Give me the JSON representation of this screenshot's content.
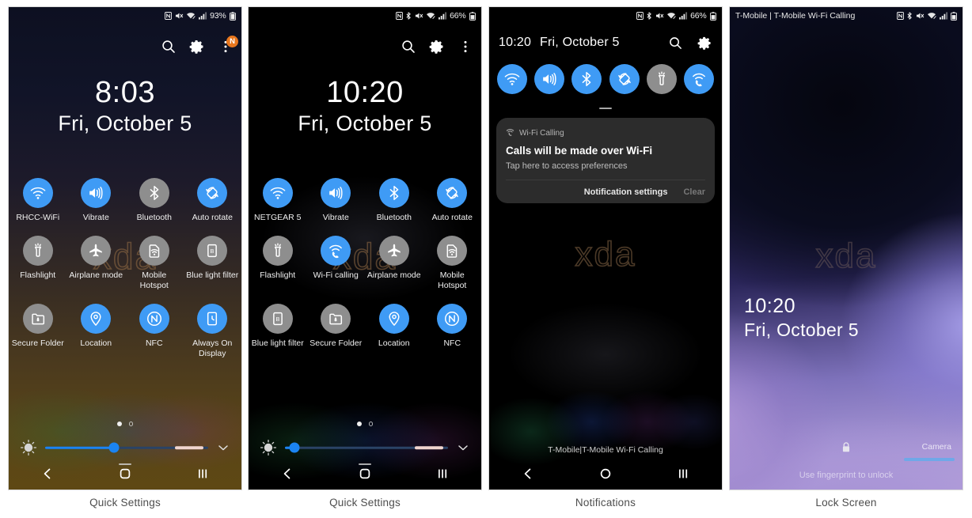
{
  "captions": [
    {
      "label": "Quick Settings"
    },
    {
      "label": "Quick Settings"
    },
    {
      "label": "Notifications"
    },
    {
      "label": "Lock Screen"
    }
  ],
  "panel1": {
    "name": "quick-settings-expanded-warm",
    "statusbar": {
      "left": "",
      "battery_percent": "93%",
      "icons": [
        "nfc-icon",
        "mute-icon",
        "wifi-icon",
        "signal-icon",
        "battery-icon"
      ]
    },
    "header": {
      "search_icon": "search-icon",
      "settings_icon": "gear-icon",
      "overflow_icon": "more-vertical-icon",
      "badge_label": "N"
    },
    "clock": {
      "time": "8:03",
      "date": "Fri, October 5"
    },
    "watermark": "xda",
    "tiles": [
      {
        "label": "RHCC-WiFi",
        "icon": "wifi-icon",
        "state": "on"
      },
      {
        "label": "Vibrate",
        "icon": "vibrate-icon",
        "state": "on"
      },
      {
        "label": "Bluetooth",
        "icon": "bluetooth-icon",
        "state": "off"
      },
      {
        "label": "Auto rotate",
        "icon": "autorotate-icon",
        "state": "on"
      },
      {
        "label": "Flashlight",
        "icon": "flashlight-icon",
        "state": "off"
      },
      {
        "label": "Airplane mode",
        "icon": "airplane-icon",
        "state": "off"
      },
      {
        "label": "Mobile Hotspot",
        "icon": "hotspot-icon",
        "state": "off"
      },
      {
        "label": "Blue light filter",
        "icon": "bluelight-icon",
        "state": "off"
      },
      {
        "label": "Secure Folder",
        "icon": "securefolder-icon",
        "state": "off"
      },
      {
        "label": "Location",
        "icon": "location-icon",
        "state": "on"
      },
      {
        "label": "NFC",
        "icon": "nfc-icon",
        "state": "on"
      },
      {
        "label": "Always On Display",
        "icon": "aod-icon",
        "state": "on"
      }
    ],
    "pages": {
      "current": 1,
      "total": 2
    },
    "brightness": {
      "value_percent": 42,
      "auto": true
    },
    "navbar": {
      "back": "back-icon",
      "home": "home-icon",
      "recents": "recents-icon"
    }
  },
  "panel2": {
    "name": "quick-settings-expanded-dark",
    "statusbar": {
      "left": "",
      "battery_percent": "66%",
      "icons": [
        "nfc-icon",
        "bluetooth-icon",
        "mute-icon",
        "wifi-icon",
        "signal-icon",
        "battery-icon"
      ]
    },
    "header": {
      "search_icon": "search-icon",
      "settings_icon": "gear-icon",
      "overflow_icon": "more-vertical-icon"
    },
    "clock": {
      "time": "10:20",
      "date": "Fri, October 5"
    },
    "watermark": "xda",
    "tiles": [
      {
        "label": "NETGEAR 5",
        "icon": "wifi-icon",
        "state": "on"
      },
      {
        "label": "Vibrate",
        "icon": "vibrate-icon",
        "state": "on"
      },
      {
        "label": "Bluetooth",
        "icon": "bluetooth-icon",
        "state": "on"
      },
      {
        "label": "Auto rotate",
        "icon": "autorotate-icon",
        "state": "on"
      },
      {
        "label": "Flashlight",
        "icon": "flashlight-icon",
        "state": "off"
      },
      {
        "label": "Wi-Fi calling",
        "icon": "wificalling-icon",
        "state": "on"
      },
      {
        "label": "Airplane mode",
        "icon": "airplane-icon",
        "state": "off"
      },
      {
        "label": "Mobile Hotspot",
        "icon": "hotspot-icon",
        "state": "off"
      },
      {
        "label": "Blue light filter",
        "icon": "bluelight-icon",
        "state": "off"
      },
      {
        "label": "Secure Folder",
        "icon": "securefolder-icon",
        "state": "off"
      },
      {
        "label": "Location",
        "icon": "location-icon",
        "state": "on"
      },
      {
        "label": "NFC",
        "icon": "nfc-icon",
        "state": "on"
      }
    ],
    "pages": {
      "current": 1,
      "total": 2
    },
    "brightness": {
      "value_percent": 6,
      "auto": true
    },
    "navbar": {
      "back": "back-icon",
      "home": "home-icon",
      "recents": "recents-icon"
    }
  },
  "panel3": {
    "name": "notification-shade",
    "statusbar": {
      "left": "",
      "battery_percent": "66%",
      "icons": [
        "nfc-icon",
        "bluetooth-icon",
        "mute-icon",
        "wifi-icon",
        "signal-icon",
        "battery-icon"
      ]
    },
    "header": {
      "time": "10:20",
      "date": "Fri, October 5",
      "search_icon": "search-icon",
      "settings_icon": "gear-icon"
    },
    "quick_tiles": [
      {
        "label": "Wi-Fi",
        "icon": "wifi-icon",
        "state": "on"
      },
      {
        "label": "Vibrate",
        "icon": "vibrate-icon",
        "state": "on"
      },
      {
        "label": "Bluetooth",
        "icon": "bluetooth-icon",
        "state": "on"
      },
      {
        "label": "Auto rotate",
        "icon": "autorotate-icon",
        "state": "on"
      },
      {
        "label": "Flashlight",
        "icon": "flashlight-icon",
        "state": "off"
      },
      {
        "label": "Wi-Fi calling",
        "icon": "wificalling-icon",
        "state": "on"
      }
    ],
    "notification": {
      "app_icon": "wificalling-icon",
      "app_name": "Wi-Fi Calling",
      "title": "Calls will be made over Wi-Fi",
      "body": "Tap here to access preferences",
      "action_settings": "Notification settings",
      "action_clear": "Clear"
    },
    "watermark": "xda",
    "carrier": "T-Mobile|T-Mobile Wi-Fi Calling",
    "navbar": {
      "back": "back-icon",
      "home": "home-icon",
      "recents": "recents-icon"
    }
  },
  "panel4": {
    "name": "lock-screen",
    "statusbar": {
      "left": "T-Mobile | T-Mobile Wi-Fi Calling",
      "battery_percent": "",
      "icons": [
        "nfc-icon",
        "bluetooth-icon",
        "mute-icon",
        "wifi-icon",
        "signal-icon",
        "battery-icon"
      ]
    },
    "watermark": "xda",
    "clock": {
      "time": "10:20",
      "date": "Fri, October 5"
    },
    "lock_icon": "lock-icon",
    "hint": "Use fingerprint to unlock",
    "camera_label": "Camera"
  },
  "colors": {
    "tile_on": "#3f9bf5",
    "tile_off": "#8e8e8e",
    "badge": "#e8771e",
    "slider": "#1b84f2",
    "notif_card": "#2c2c2c"
  }
}
